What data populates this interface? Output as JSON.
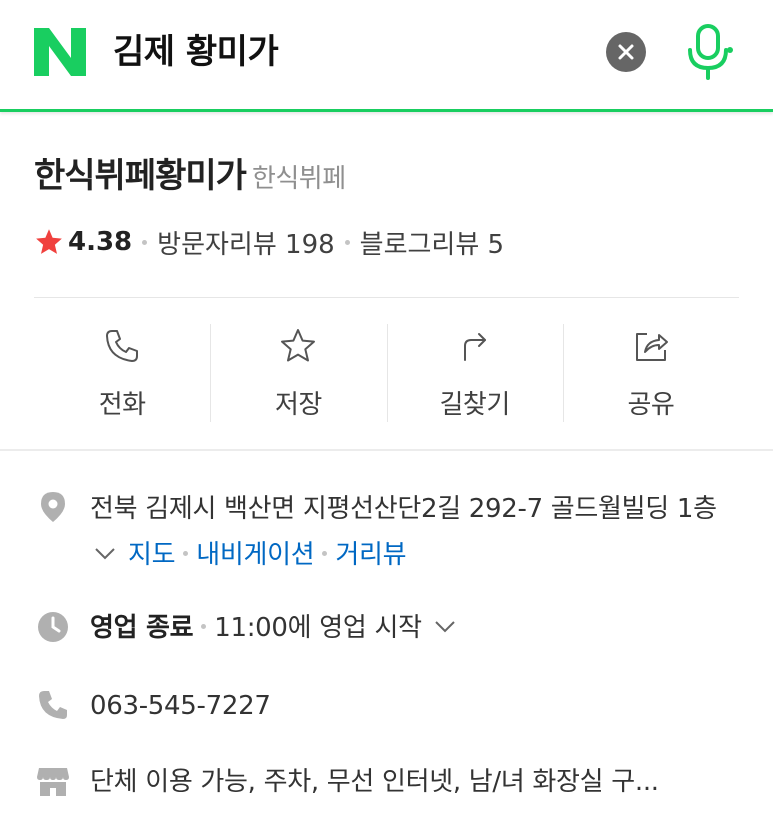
{
  "search": {
    "query": "김제 황미가"
  },
  "place": {
    "name": "한식뷔페황미가",
    "category": "한식뷔페",
    "rating": "4.38",
    "visitor_reviews": "방문자리뷰 198",
    "blog_reviews": "블로그리뷰 5"
  },
  "actions": [
    {
      "label": "전화",
      "icon": "phone-icon"
    },
    {
      "label": "저장",
      "icon": "star-outline-icon"
    },
    {
      "label": "길찾기",
      "icon": "directions-icon"
    },
    {
      "label": "공유",
      "icon": "share-icon"
    }
  ],
  "info": {
    "address": "전북 김제시 백산면 지평선산단2길 292-7 골드월빌딩 1층",
    "links": {
      "map": "지도",
      "navigation": "내비게이션",
      "street_view": "거리뷰"
    },
    "hours_status": "영업 종료",
    "hours_next": "11:00에 영업 시작",
    "phone": "063-545-7227",
    "facilities": "단체 이용 가능, 주차, 무선 인터넷, 남/녀 화장실 구..."
  },
  "colors": {
    "brand": "#19ce60",
    "star": "#f0413e",
    "link": "#0068c3",
    "icon_gray": "#aaaaaa"
  }
}
